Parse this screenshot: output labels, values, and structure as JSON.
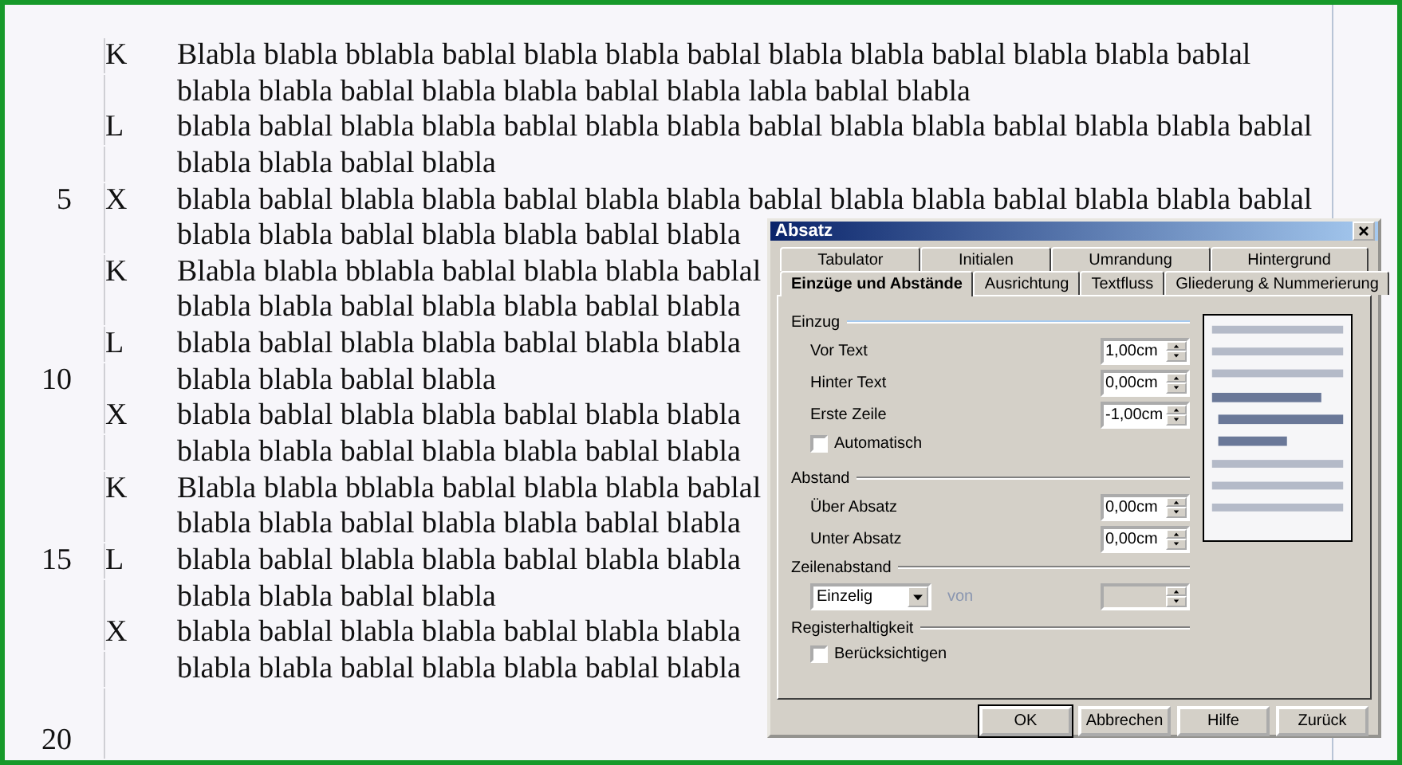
{
  "document": {
    "lines": [
      {
        "marker": "K",
        "text": "Blabla blabla bblabla bablal blabla blabla bablal blabla blabla bablal blabla blabla bablal"
      },
      {
        "text": "blabla blabla bablal blabla blabla bablal blabla labla bablal blabla"
      },
      {
        "marker": "L",
        "text": "blabla bablal blabla blabla bablal blabla blabla bablal blabla blabla bablal blabla blabla bablal"
      },
      {
        "text": "blabla blabla bablal blabla"
      },
      {
        "number": "5",
        "marker": "X",
        "text": "blabla bablal blabla blabla bablal blabla blabla bablal blabla blabla bablal blabla blabla bablal"
      },
      {
        "text": "blabla blabla bablal blabla blabla bablal blabla"
      },
      {
        "marker": "K",
        "text": "Blabla blabla bblabla bablal blabla blabla bablal"
      },
      {
        "text": "blabla blabla bablal blabla blabla bablal blabla"
      },
      {
        "marker": "L",
        "text": "blabla bablal blabla blabla bablal blabla blabla"
      },
      {
        "number": "10",
        "text": "blabla blabla bablal blabla"
      },
      {
        "marker": "X",
        "text": "blabla bablal blabla blabla bablal blabla blabla"
      },
      {
        "text": "blabla blabla bablal blabla blabla bablal blabla"
      },
      {
        "marker": "K",
        "text": "Blabla blabla bblabla bablal blabla blabla bablal"
      },
      {
        "text": "blabla blabla bablal blabla blabla bablal blabla"
      },
      {
        "number": "15",
        "marker": "L",
        "text": "blabla bablal blabla blabla bablal blabla blabla"
      },
      {
        "text": "blabla blabla bablal blabla"
      },
      {
        "marker": "X",
        "text": "blabla bablal blabla blabla bablal blabla blabla"
      },
      {
        "text": "blabla blabla bablal blabla blabla bablal blabla"
      }
    ],
    "last_number": "20"
  },
  "dialog": {
    "title": "Absatz",
    "tabs_row1": [
      {
        "label": "Tabulator",
        "selected": false
      },
      {
        "label": "Initialen",
        "selected": false
      },
      {
        "label": "Umrandung",
        "selected": false
      },
      {
        "label": "Hintergrund",
        "selected": false
      }
    ],
    "tabs_row2": [
      {
        "label": "Einzüge und Abstände",
        "selected": true
      },
      {
        "label": "Ausrichtung",
        "selected": false
      },
      {
        "label": "Textfluss",
        "selected": false
      },
      {
        "label": "Gliederung & Nummerierung",
        "selected": false
      }
    ],
    "sections": [
      {
        "title": "Einzug",
        "rows": [
          {
            "kind": "spin",
            "label": "Vor Text",
            "value": "1,00cm"
          },
          {
            "kind": "spin",
            "label": "Hinter Text",
            "value": "0,00cm"
          },
          {
            "kind": "spin",
            "label": "Erste Zeile",
            "value": "-1,00cm"
          },
          {
            "kind": "check",
            "label": "Automatisch",
            "checked": false
          }
        ]
      },
      {
        "title": "Abstand",
        "rows": [
          {
            "kind": "spin",
            "label": "Über Absatz",
            "value": "0,00cm"
          },
          {
            "kind": "spin",
            "label": "Unter Absatz",
            "value": "0,00cm"
          }
        ]
      },
      {
        "title": "Zeilenabstand",
        "rows": [
          {
            "kind": "select",
            "value": "Einzelig",
            "label": "von",
            "disabled": true
          }
        ]
      },
      {
        "title": "Registerhaltigkeit",
        "rows": [
          {
            "kind": "check",
            "label": "Berücksichtigen",
            "checked": false
          }
        ]
      }
    ],
    "buttons": [
      {
        "label": "OK",
        "default": true
      },
      {
        "label": "Abbrechen",
        "default": false
      },
      {
        "label": "Hilfe",
        "default": false
      },
      {
        "label": "Zurück",
        "default": false
      }
    ]
  }
}
